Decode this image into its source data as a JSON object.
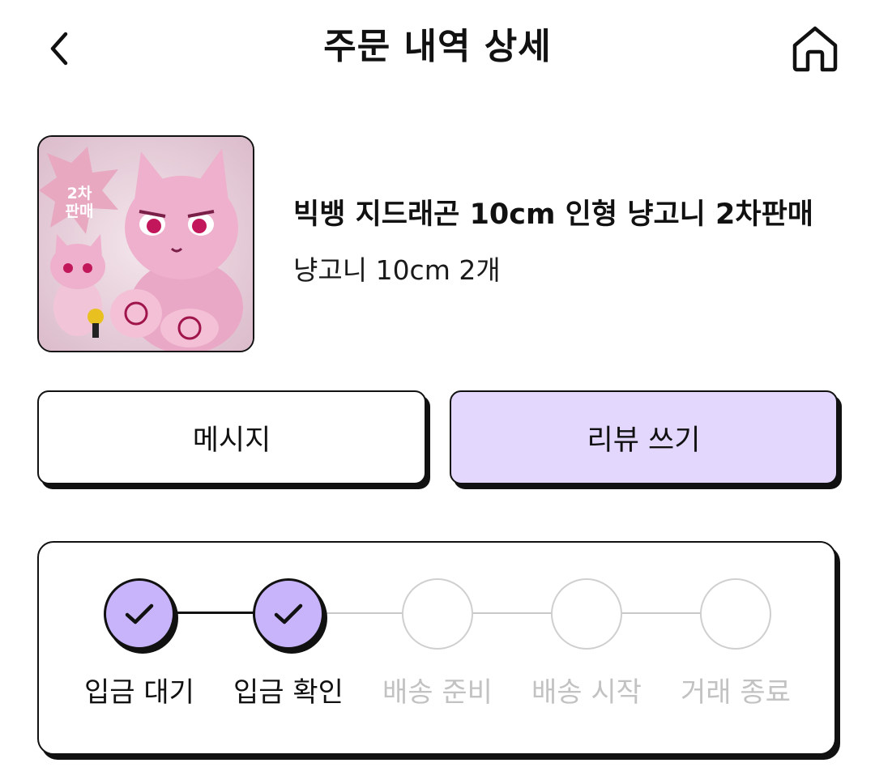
{
  "header": {
    "title": "주문 내역 상세",
    "back_icon": "chevron-left-icon",
    "home_icon": "home-icon"
  },
  "product": {
    "title": "빅뱅 지드래곤 10cm 인형 냥고니 2차판매",
    "option": "냥고니 10cm 2개",
    "image_badge": "2차 판매"
  },
  "actions": {
    "message_label": "메시지",
    "review_label": "리뷰 쓰기"
  },
  "status": {
    "steps": [
      {
        "label": "입금 대기",
        "done": true
      },
      {
        "label": "입금 확인",
        "done": true
      },
      {
        "label": "배송 준비",
        "done": false
      },
      {
        "label": "배송 시작",
        "done": false
      },
      {
        "label": "거래 종료",
        "done": false
      }
    ]
  },
  "colors": {
    "accent": "#c8b4fa",
    "review_button_bg": "#e3d7fd",
    "inactive": "#c2c2c2",
    "border": "#111111"
  }
}
